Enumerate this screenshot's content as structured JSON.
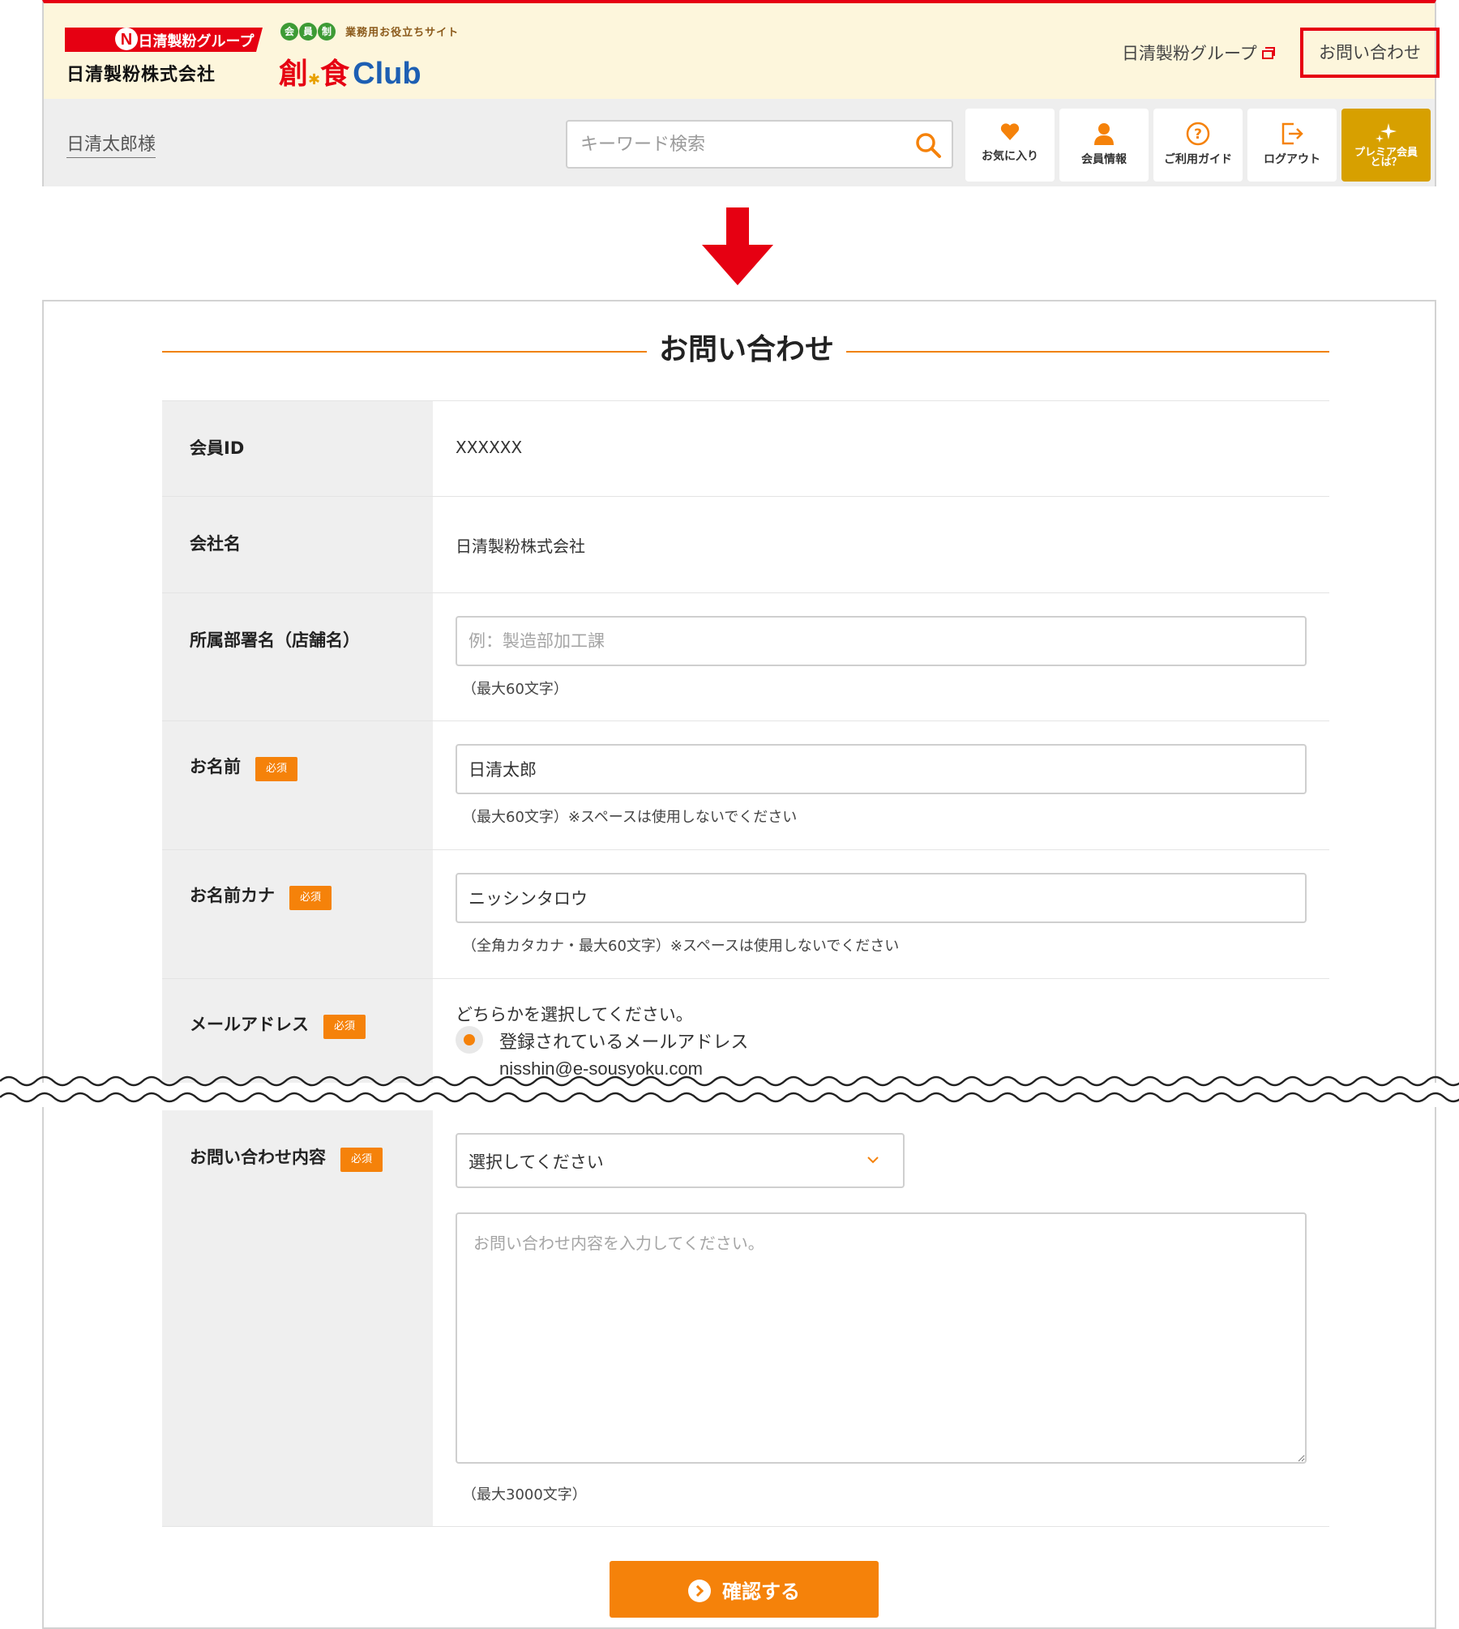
{
  "header": {
    "group_logo_text": "日清製粉グループ",
    "company_name": "日清製粉株式会社",
    "club_badge_chars": [
      "会",
      "員",
      "制"
    ],
    "club_tagline": "業務用お役立ちサイト",
    "club_name_jp": "創",
    "club_name_jp2": "食",
    "club_name_en": "Club",
    "group_link": "日清製粉グループ",
    "inquiry_link": "お問い合わせ",
    "user_name": "日清太郎様",
    "search_placeholder": "キーワード検索",
    "nav": {
      "favorites": "お気に入り",
      "member_info": "会員情報",
      "guide": "ご利用ガイド",
      "logout": "ログアウト",
      "premium_line1": "プレミア会員",
      "premium_line2": "とは？"
    }
  },
  "form": {
    "title": "お問い合わせ",
    "member_id": {
      "label": "会員ID",
      "value": "XXXXXX"
    },
    "company": {
      "label": "会社名",
      "value": "日清製粉株式会社"
    },
    "department": {
      "label": "所属部署名（店舗名）",
      "placeholder": "例：製造部加工課",
      "note": "（最大60文字）"
    },
    "name": {
      "label": "お名前",
      "required": "必須",
      "value": "日清太郎",
      "note": "（最大60文字）※スペースは使用しないでください"
    },
    "name_kana": {
      "label": "お名前カナ",
      "required": "必須",
      "value": "ニッシンタロウ",
      "note": "（全角カタカナ・最大60文字）※スペースは使用しないでください"
    },
    "email": {
      "label": "メールアドレス",
      "required": "必須",
      "intro": "どちらかを選択してください。",
      "option_label": "登録されているメールアドレス",
      "address": "nisshin@e-sousyoku.com"
    },
    "inquiry": {
      "label": "お問い合わせ内容",
      "required": "必須",
      "select_value": "選択してください",
      "textarea_placeholder": "お問い合わせ内容を入力してください。",
      "note": "（最大3000文字）"
    },
    "confirm_button": "確認する"
  },
  "colors": {
    "accent": "#f5820a",
    "brand_red": "#e60012",
    "premium": "#d7a000",
    "header_bg": "#fdf6dc"
  }
}
